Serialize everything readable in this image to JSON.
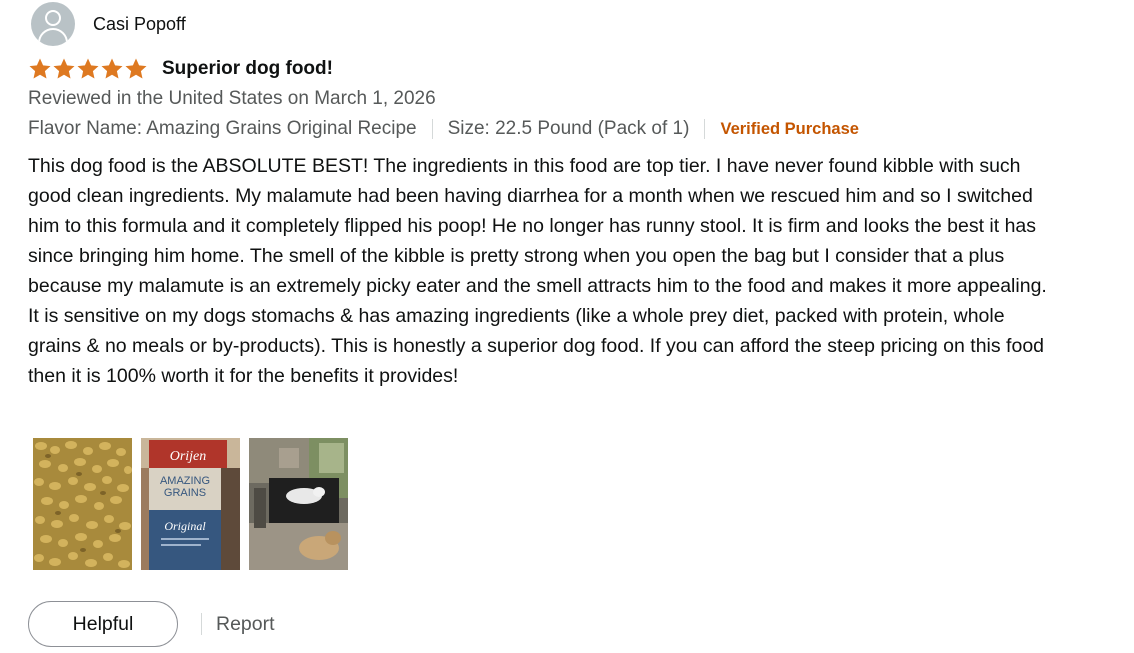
{
  "review": {
    "reviewer_name": "Casi Popoff",
    "rating": 5,
    "rating_max": 5,
    "title": "Superior dog food!",
    "date_line": "Reviewed in the United States on March 1, 2026",
    "flavor": "Flavor Name: Amazing Grains Original Recipe",
    "size": "Size: 22.5 Pound (Pack of 1)",
    "verified_label": "Verified Purchase",
    "body": "This dog food is the ABSOLUTE BEST! The ingredients in this food are top tier. I have never found kibble with such good clean ingredients. My malamute had been having diarrhea for a month when we rescued him and so I switched him to this formula and it completely flipped his poop! He no longer has runny stool. It is firm and looks the best it has since bringing him home. The smell of the kibble is pretty strong when you open the bag but I consider that a plus because my malamute is an extremely picky eater and the smell attracts him to the food and makes it more appealing. It is sensitive on my dogs stomachs & has amazing ingredients (like a whole prey diet, packed with protein, whole grains & no meals or by-products). This is honestly a superior dog food. If you can afford the steep pricing on this food then it is 100% worth it for the benefits it provides!",
    "images": [
      {
        "name": "kibble-photo"
      },
      {
        "name": "food-bag-photo",
        "bag_text": [
          "Orijen",
          "AMAZING",
          "GRAINS",
          "Original"
        ]
      },
      {
        "name": "dogs-photo"
      }
    ]
  },
  "actions": {
    "helpful_label": "Helpful",
    "report_label": "Report"
  },
  "colors": {
    "star": "#de7921",
    "verified": "#c45500",
    "secondary_text": "#565959",
    "primary_text": "#0f1111",
    "avatar_bg": "#b9c2c6"
  }
}
